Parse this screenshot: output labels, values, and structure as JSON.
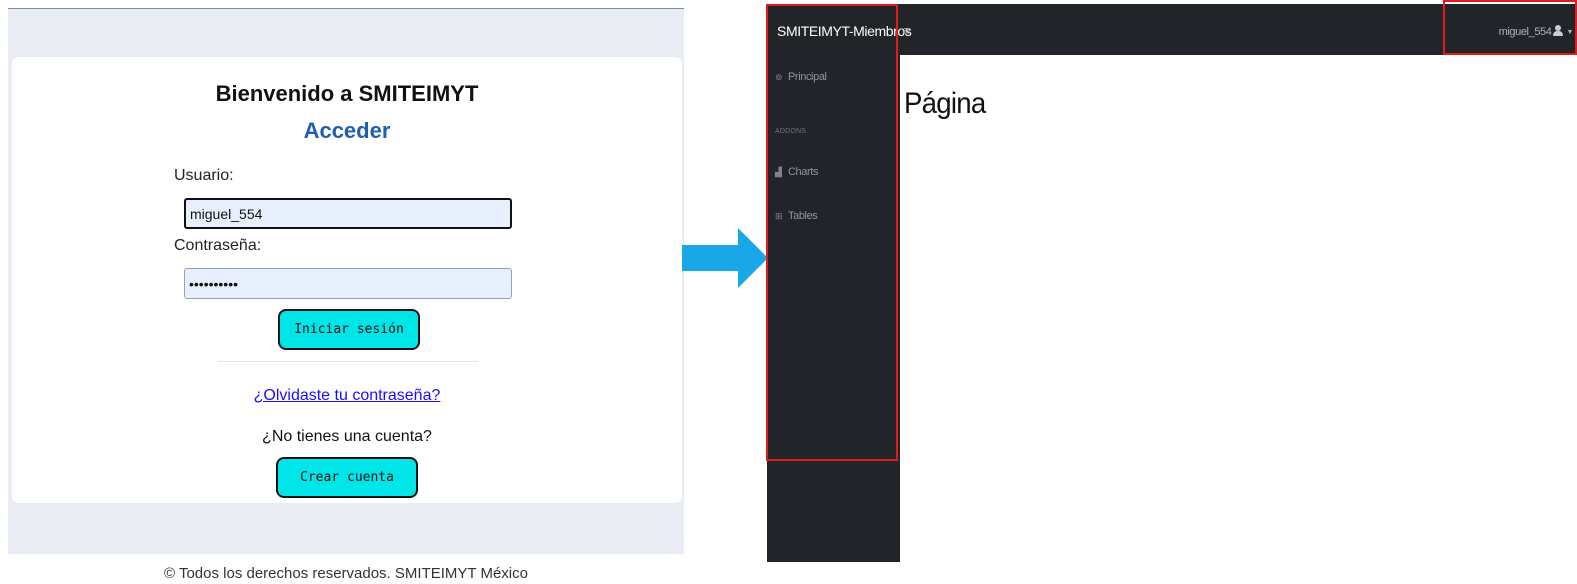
{
  "login": {
    "title": "Bienvenido a SMITEIMYT",
    "subtitle": "Acceder",
    "username_label": "Usuario:",
    "username_value": "miguel_554",
    "password_label": "Contraseña:",
    "password_value": "••••••••••",
    "login_button": "Iniciar sesión",
    "forgot_link": "¿Olvidaste tu contraseña?",
    "no_account_text": "¿No tienes una cuenta?",
    "create_button": "Crear cuenta",
    "footer": "© Todos los derechos reservados. SMITEIMYT México"
  },
  "transition": {
    "icon": "arrow-right-icon",
    "color": "#1aa7e8"
  },
  "dashboard": {
    "brand": "SMITEIMYT-Miembros",
    "menu_toggle": "≡",
    "user_name": "miguel_554",
    "sidebar": {
      "items": [
        {
          "label": "Principal",
          "icon": "dashboard-icon"
        },
        {
          "label": "Charts",
          "icon": "chart-area-icon"
        },
        {
          "label": "Tables",
          "icon": "table-icon"
        }
      ],
      "section_heading": "ADDONS"
    },
    "page_heading": "Página",
    "highlight_color": "#e01b1b"
  }
}
